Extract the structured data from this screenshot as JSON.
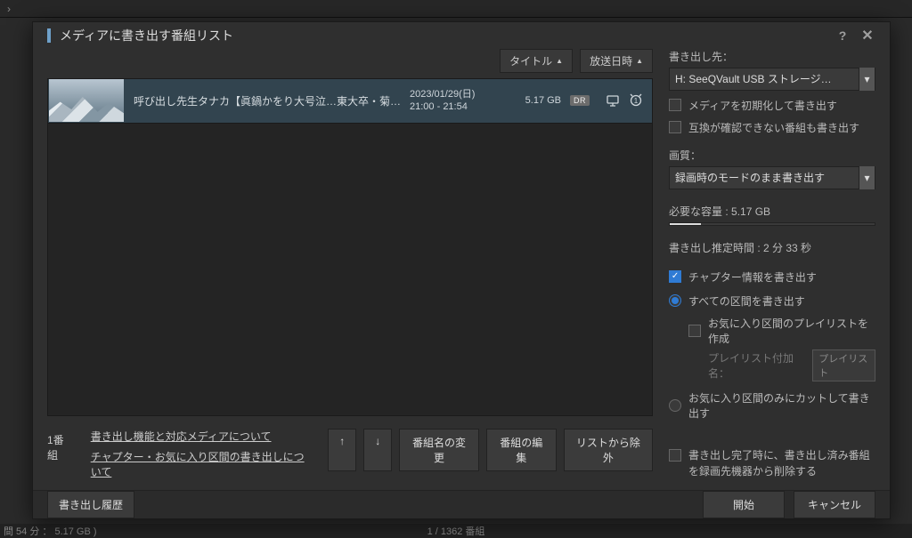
{
  "backdrop": {
    "bottom_left": "間 54 分 ： 5.17 GB )",
    "bottom_center": "1 / 1362 番組"
  },
  "dialog": {
    "title": "メディアに書き出す番組リスト"
  },
  "sort": {
    "title_btn": "タイトル",
    "airdate_btn": "放送日時"
  },
  "list": {
    "items": [
      {
        "title": "呼び出し先生タナカ【眞鍋かをり大号泣…東大卒・菊…",
        "date": "2023/01/29(日)",
        "time": "21:00 - 21:54",
        "size": "5.17 GB",
        "badge": "DR"
      }
    ]
  },
  "left_footer": {
    "count": "1番組",
    "link1": "書き出し機能と対応メディアについて",
    "link2": "チャプター・お気に入り区間の書き出しについて",
    "up": "↑",
    "down": "↓",
    "rename": "番組名の変更",
    "edit": "番組の編集",
    "remove": "リストから除外"
  },
  "right": {
    "dest_label": "書き出し先：",
    "dest_value": "H: SeeQVault USB ストレージ…",
    "init_media": "メディアを初期化して書き出す",
    "write_unconfirmed": "互換が確認できない番組も書き出す",
    "quality_label": "画質：",
    "quality_value": "録画時のモードのまま書き出す",
    "needed_label": "必要な容量 :",
    "needed_value": "5.17 GB",
    "eta_label": "書き出し推定時間 :",
    "eta_value": "2 分 33 秒",
    "chapter": "チャプター情報を書き出す",
    "all_segments": "すべての区間を書き出す",
    "fav_playlist": "お気に入り区間のプレイリストを作成",
    "playlist_add_label": "プレイリスト付加名：",
    "playlist_add_btn": "プレイリスト",
    "fav_only": "お気に入り区間のみにカットして書き出す",
    "delete_after": "書き出し完了時に、書き出し済み番組を録画先機器から削除する"
  },
  "footer": {
    "history": "書き出し履歴",
    "start": "開始",
    "cancel": "キャンセル"
  }
}
